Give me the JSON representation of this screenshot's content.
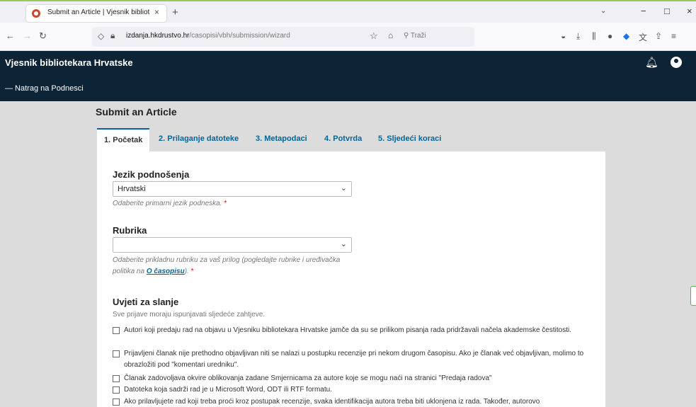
{
  "browser": {
    "tab_title": "Submit an Article | Vjesnik bibliotek…",
    "tab_close": "×",
    "new_tab": "+",
    "url_host": "izdanja.hkdrustvo.hr",
    "url_path": "/casopisi/vbh/submission/wizard",
    "search_placeholder": "Traži",
    "dropdown": "⌄",
    "minimize": "−",
    "maximize": "□",
    "close": "×"
  },
  "site": {
    "title": "Vjesnik bibliotekara Hrvatske",
    "back_link": "— Natrag na Podnesci"
  },
  "page": {
    "title": "Submit an Article",
    "tabs": [
      {
        "label": "1. Početak"
      },
      {
        "label": "2. Prilaganje datoteke"
      },
      {
        "label": "3. Metapodaci"
      },
      {
        "label": "4. Potvrda"
      },
      {
        "label": "5. Sljedeći koraci"
      }
    ]
  },
  "form": {
    "language": {
      "label": "Jezik podnošenja",
      "value": "Hrvatski",
      "help": "Odaberite primarni jezik podneska.",
      "required": "*"
    },
    "section": {
      "label": "Rubrika",
      "value": "",
      "help_prefix": "Odaberite prikladnu rubriku za vaš prilog (pogledajte rubrike i uređivačka politika na ",
      "help_link": "O časopisu",
      "help_suffix": ").",
      "required": "*"
    },
    "requirements": {
      "label": "Uvjeti za slanje",
      "subtitle": "Sve prijave moraju ispunjavati sljedeće zahtjeve.",
      "items": [
        {
          "text": "Autori koji predaju rad na objavu u Vjesniku bibliotekara Hrvatske jamče da su se prilikom pisanja rada pridržavali načela akademske čestitosti."
        },
        {
          "text": "Prijavljeni članak nije prethodno objavljivan niti se nalazi u postupku recenzije pri nekom drugom časopisu. Ako je članak već objavljivan, molimo to obrazložiti pod \"komentari uredniku\"."
        },
        {
          "text": "Članak zadovoljava okvire oblikovanja zadane Smjernicama za autore koje se mogu naći na stranici \"Predaja radova\""
        },
        {
          "text": "Datoteka koja sadrži rad je u Microsoft Word, ODT ili RTF formatu."
        },
        {
          "text": "Ako prilavljujete rad koji treba proći kroz postupak recenzije, svaka identifikacija autora treba biti uklonjena iz rada. Također, autorovo"
        }
      ]
    }
  }
}
